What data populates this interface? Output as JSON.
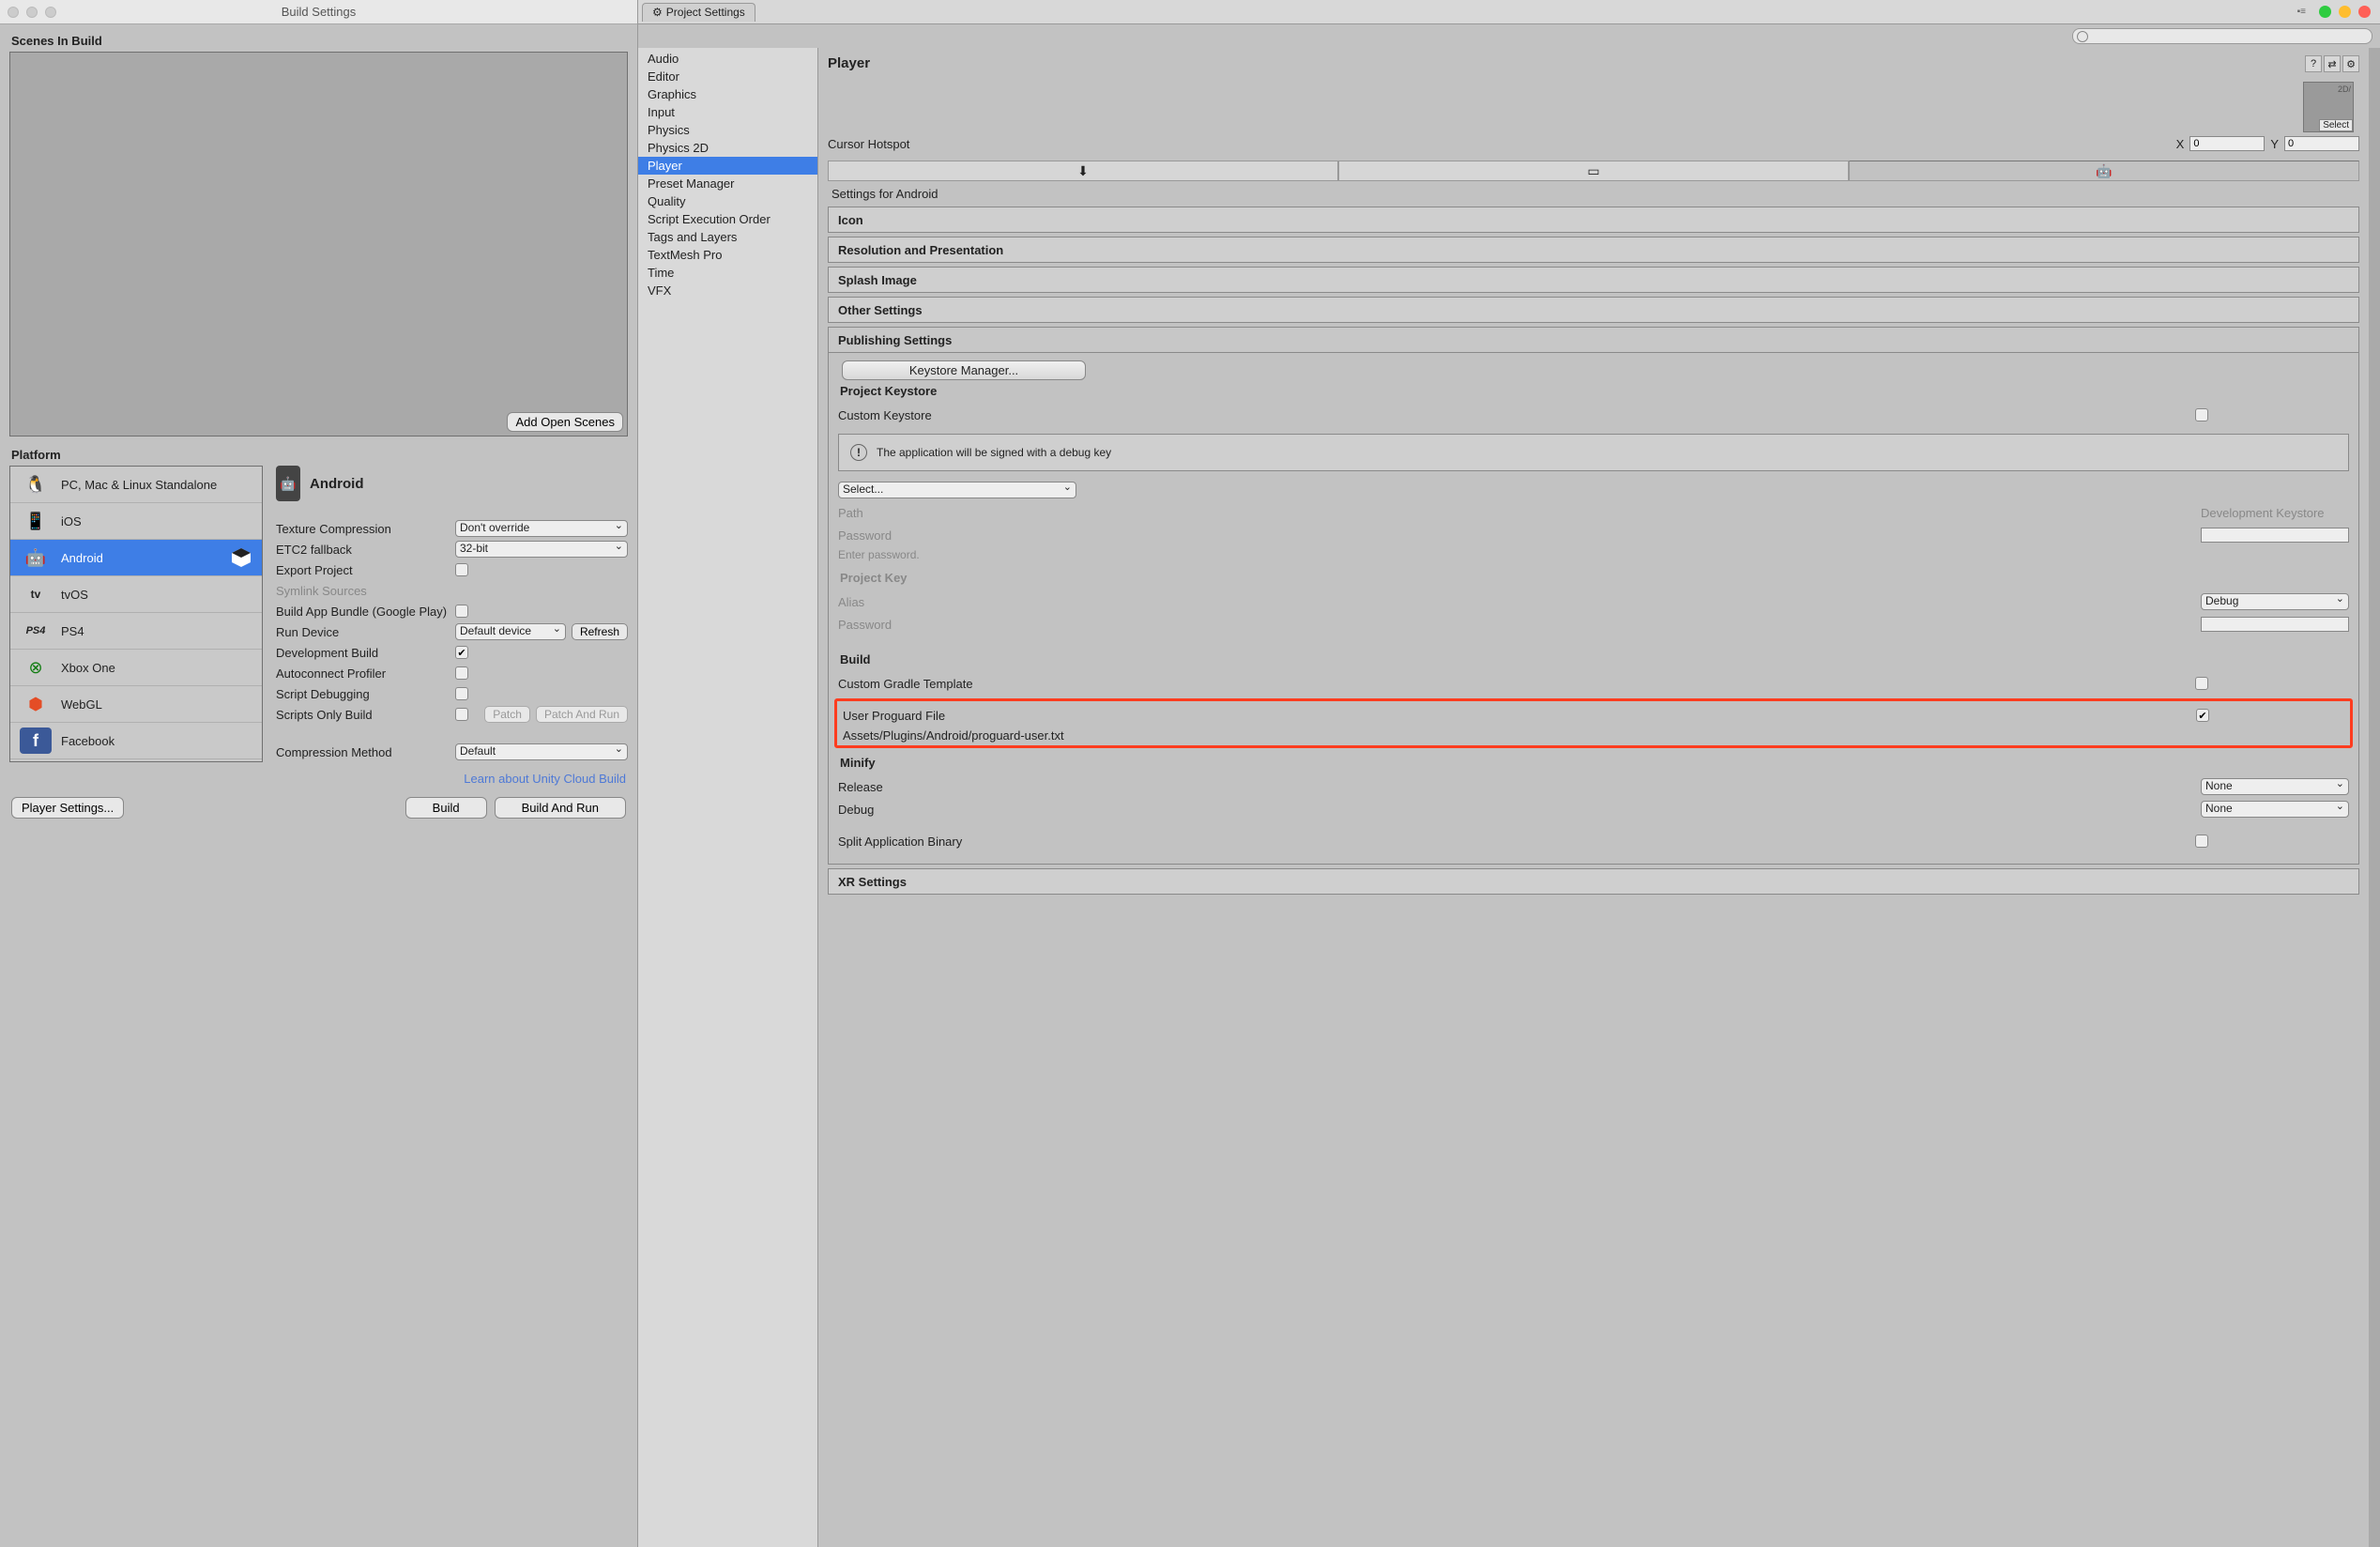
{
  "buildWindow": {
    "title": "Build Settings",
    "scenesLabel": "Scenes In Build",
    "addOpenScenes": "Add Open Scenes",
    "platformLabel": "Platform",
    "platforms": [
      {
        "name": "PC, Mac & Linux Standalone"
      },
      {
        "name": "iOS"
      },
      {
        "name": "Android",
        "selected": true
      },
      {
        "name": "tvOS"
      },
      {
        "name": "PS4"
      },
      {
        "name": "Xbox One"
      },
      {
        "name": "WebGL"
      },
      {
        "name": "Facebook"
      }
    ],
    "detailHeader": "Android",
    "options": {
      "textureCompression": {
        "label": "Texture Compression",
        "value": "Don't override"
      },
      "etc2": {
        "label": "ETC2 fallback",
        "value": "32-bit"
      },
      "exportProject": {
        "label": "Export Project",
        "checked": false
      },
      "symlink": {
        "label": "Symlink Sources",
        "disabled": true
      },
      "buildAppBundle": {
        "label": "Build App Bundle (Google Play)",
        "checked": false
      },
      "runDevice": {
        "label": "Run Device",
        "value": "Default device",
        "refresh": "Refresh"
      },
      "devBuild": {
        "label": "Development Build",
        "checked": true
      },
      "autoconnect": {
        "label": "Autoconnect Profiler",
        "checked": false
      },
      "scriptDebug": {
        "label": "Script Debugging",
        "checked": false
      },
      "scriptsOnly": {
        "label": "Scripts Only Build",
        "checked": false,
        "patch": "Patch",
        "patchRun": "Patch And Run"
      },
      "compression": {
        "label": "Compression Method",
        "value": "Default"
      }
    },
    "cloudLink": "Learn about Unity Cloud Build",
    "playerSettingsBtn": "Player Settings...",
    "build": "Build",
    "buildAndRun": "Build And Run"
  },
  "projectSettings": {
    "tabTitle": "Project Settings",
    "sidebar": [
      "Audio",
      "Editor",
      "Graphics",
      "Input",
      "Physics",
      "Physics 2D",
      "Player",
      "Preset Manager",
      "Quality",
      "Script Execution Order",
      "Tags and Layers",
      "TextMesh Pro",
      "Time",
      "VFX"
    ],
    "selected": "Player",
    "mainTitle": "Player",
    "thumbCaption": "2D/",
    "thumbSelect": "Select",
    "cursorHotspot": {
      "label": "Cursor Hotspot",
      "xl": "X",
      "x": "0",
      "yl": "Y",
      "y": "0"
    },
    "settingsFor": "Settings for Android",
    "foldouts": {
      "icon": "Icon",
      "resolution": "Resolution and Presentation",
      "splash": "Splash Image",
      "other": "Other Settings",
      "publishing": "Publishing Settings",
      "xr": "XR Settings"
    },
    "publishing": {
      "keystoreMgr": "Keystore Manager...",
      "projectKeystoreTitle": "Project Keystore",
      "customKeystore": {
        "label": "Custom Keystore",
        "checked": false
      },
      "debugMsg": "The application will be signed with a debug key",
      "selectDropdown": "Select...",
      "path": {
        "label": "Path",
        "value": "Development Keystore"
      },
      "password": {
        "label": "Password",
        "hint": "Enter password."
      },
      "projectKeyTitle": "Project Key",
      "alias": {
        "label": "Alias",
        "value": "Debug"
      },
      "password2": {
        "label": "Password"
      },
      "buildTitle": "Build",
      "customGradle": {
        "label": "Custom Gradle Template",
        "checked": false
      },
      "userProguard": {
        "label": "User Proguard File",
        "checked": true,
        "path": "Assets/Plugins/Android/proguard-user.txt"
      },
      "minifyTitle": "Minify",
      "release": {
        "label": "Release",
        "value": "None"
      },
      "debug": {
        "label": "Debug",
        "value": "None"
      },
      "splitBinary": {
        "label": "Split Application Binary",
        "checked": false
      }
    }
  }
}
